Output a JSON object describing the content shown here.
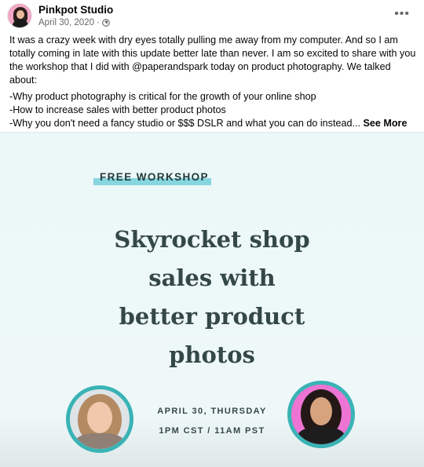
{
  "post": {
    "author": "Pinkpot Studio",
    "date": "April 30, 2020",
    "separator": "·",
    "more_icon": "more-horizontal-icon",
    "privacy_icon": "globe-icon"
  },
  "caption": {
    "paragraph": "It was a crazy week with dry eyes totally pulling me away from my computer. And so I am totally coming in late with this update better late than never. I am so excited to share with you the workshop that I did with @paperandspark today on product photography. We talked about:",
    "bullets": [
      "-Why product photography is critical for the growth of your online shop",
      "-How to increase sales with better product photos",
      "-Why you don't need a fancy studio or $$$ DSLR and what you can do instead..."
    ],
    "see_more": "See More"
  },
  "flyer": {
    "badge": "FREE WORKSHOP",
    "headline_lines": [
      "Skyrocket shop",
      "sales with",
      "better product",
      "photos"
    ],
    "date_line": "APRIL 30, THURSDAY",
    "time_line": "1PM CST / 11AM PST",
    "colors": {
      "background": "#ecf7f8",
      "accent": "#3ab3b5",
      "badge_highlight": "#86d6df",
      "headline": "#344847",
      "right_photo_bg": "#ee74d3"
    }
  }
}
